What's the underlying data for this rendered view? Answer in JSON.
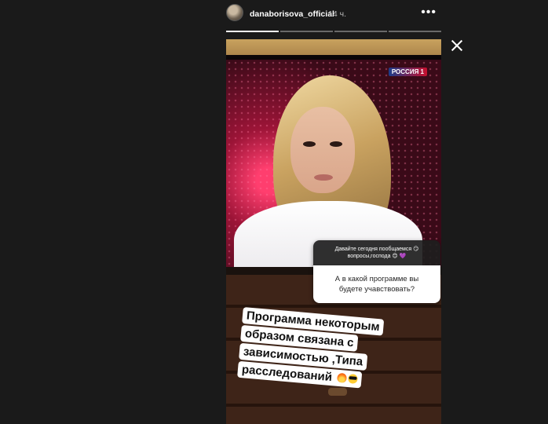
{
  "header": {
    "username": "danaborisova_official",
    "time": "14 ч.",
    "more_glyph": "•••",
    "avatar_icon": "profile-avatar"
  },
  "progress": {
    "total_segments": 4,
    "completed_segments": 1
  },
  "close_icon": "close-icon",
  "story": {
    "channel_badge": "РОССИЯ 1",
    "question_prompt": "Давайте сегодня пообщаемся 😏 вопросы,господа 😊 💜",
    "question_text": "А в какой программе вы будете учавствовать?",
    "caption_lines": [
      "Программа некоторым",
      "образом связана с",
      "зависимостью ,Типа",
      "расследований"
    ],
    "caption_emojis": [
      "fire-emoji",
      "cool-emoji"
    ]
  }
}
